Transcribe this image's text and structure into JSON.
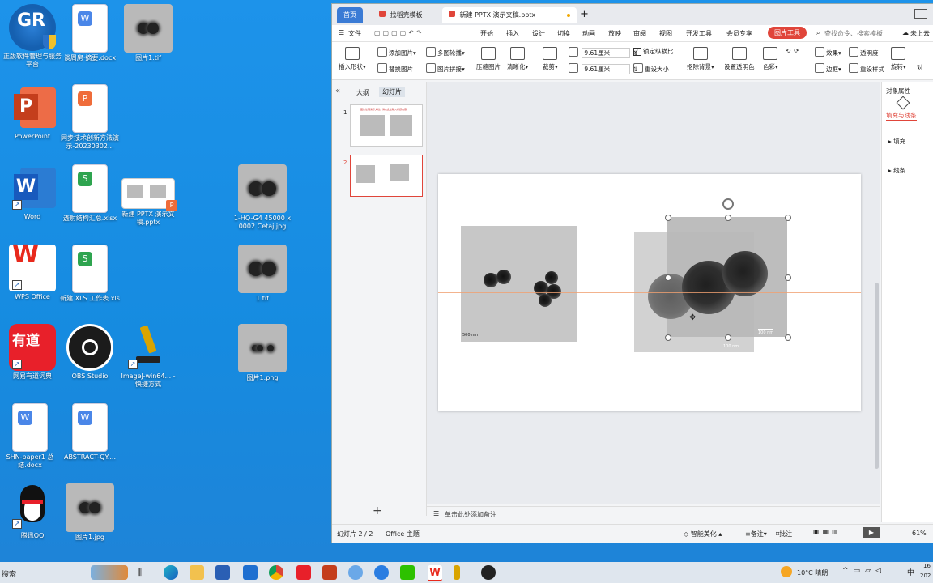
{
  "desktop": {
    "icons": [
      {
        "label": "正版软件管理与服务平台",
        "kind": "gr"
      },
      {
        "label": "谈周房·摘要.docx",
        "kind": "word-doc"
      },
      {
        "label": "图片1.tif",
        "kind": "tem"
      },
      {
        "label": "PowerPoint",
        "kind": "ppt"
      },
      {
        "label": "同步技术创新方法演示-20230302...",
        "kind": "ppt-doc"
      },
      {
        "label": "Word",
        "kind": "word"
      },
      {
        "label": "透射结构汇总.xlsx",
        "kind": "xls-doc"
      },
      {
        "label": "新建 PPTX 演示文稿.pptx",
        "kind": "pptx-thumb"
      },
      {
        "label": "1-HQ-G4 45000 x 0002 Cetaj.jpg",
        "kind": "tem"
      },
      {
        "label": "WPS Office",
        "kind": "wps"
      },
      {
        "label": "新建 XLS 工作表.xls",
        "kind": "xls-doc"
      },
      {
        "label": "1.tif",
        "kind": "tem"
      },
      {
        "label": "网易有道词典",
        "kind": "youdao"
      },
      {
        "label": "OBS Studio",
        "kind": "obs"
      },
      {
        "label": "ImageJ-win64... - 快捷方式",
        "kind": "imagej"
      },
      {
        "label": "图片1.png",
        "kind": "tem"
      },
      {
        "label": "SHN-paper1 总结.docx",
        "kind": "word-doc"
      },
      {
        "label": "ABSTRACT-QY....",
        "kind": "word-doc"
      },
      {
        "label": "腾讯QQ",
        "kind": "qq"
      },
      {
        "label": "图片1.jpg",
        "kind": "tem"
      }
    ]
  },
  "app": {
    "tabs": [
      {
        "label": "首页"
      },
      {
        "label": "找稻壳模板"
      },
      {
        "label": "新建 PPTX 演示文稿.pptx"
      }
    ],
    "menu": [
      "文件",
      "开始",
      "插入",
      "设计",
      "切换",
      "动画",
      "放映",
      "审阅",
      "视图",
      "开发工具",
      "会员专享",
      "图片工具"
    ],
    "search_placeholder": "查找命令、搜索模板",
    "cloud_label": "未上云",
    "ribbon": {
      "insert_shape": "插入形状",
      "add_picture": "添加图片",
      "multi_outline": "多图轮播",
      "replace_picture": "替换图片",
      "picture_join": "图片拼接",
      "compress": "压缩图片",
      "clarity": "清晰化",
      "crop": "裁剪",
      "height": "9.61厘米",
      "width": "9.61厘米",
      "lock_ratio": "锁定纵横比",
      "reset_size": "重设大小",
      "matting": "抠除背景",
      "set_transparent": "设置透明色",
      "color": "色彩",
      "effects": "效果",
      "transparency": "透明度",
      "border": "边框",
      "reset_style": "重设样式",
      "rotate": "旋转",
      "align": "对"
    },
    "panel_tabs": {
      "outline": "大纲",
      "slides": "幻灯片"
    },
    "slide_numbers": [
      "1",
      "2"
    ],
    "slide1_title": "图片处理演示文档，请在此处输入标题内容",
    "scale_bar_left": "500 nm",
    "scale_bar_right": "100 nm",
    "scale_bar_right2": "100 nm",
    "notes_placeholder": "单击此处添加备注",
    "right_panel": {
      "title": "对象属性",
      "tab": "填充与线条",
      "fill": "填充",
      "line": "线条"
    },
    "status": {
      "slide_count": "幻灯片 2 / 2",
      "theme": "Office 主题",
      "smart": "智能美化",
      "notes": "备注",
      "comments": "批注",
      "zoom": "61%"
    }
  },
  "taskbar": {
    "search": "搜索",
    "weather": "10°C 晴朗",
    "ime": "中",
    "clock_top": "16",
    "clock_bottom": "202"
  },
  "colors": {
    "accent": "#e0453a",
    "desktop": "#1a8fe6",
    "guide": "#f0a070"
  }
}
